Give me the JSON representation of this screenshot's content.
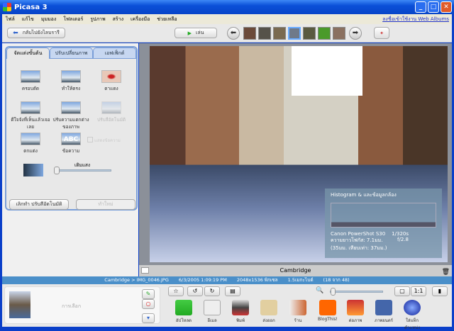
{
  "window": {
    "title": "Picasa 3"
  },
  "menu": [
    "ไฟล์",
    "แก้ไข",
    "มุมมอง",
    "โฟลเดอร์",
    "รูปภาพ",
    "สร้าง",
    "เครื่องมือ",
    "ช่วยเหลือ"
  ],
  "menu_link": "ลงชื่อเข้าใช้งาน Web Albums",
  "toolbar": {
    "back_label": "กลับไปยังไลบรารี",
    "play_label": "เล่น"
  },
  "tabs": [
    "จัดแต่งขั้นต้น",
    "ปรับเปลี่ยนภาพ",
    "เอฟเฟ็กต์"
  ],
  "tools": [
    "ครอบตัด",
    "ทำให้ตรง",
    "ตาแดง",
    "ดีใจจังที่เห็นแล้วเจอเลย",
    "ปรับความแตกต่างของภาพ",
    "ปรับสีอัตโนมัติ",
    "ตกแต่ง",
    "ข้อความ"
  ],
  "show_text_checkbox": "แสดงข้อความ",
  "fill_light_label": "เติมแสง",
  "fill_light_value": 0,
  "undo_label": "เลิกทำ ปรับสีอัตโนมัติ",
  "redo_label": "ทำใหม่",
  "histogram": {
    "title": "Histogram & และข้อมูลกล้อง",
    "camera": "Canon PowerShot S30",
    "shutter": "1/320s",
    "focal": "ความยาวโฟกัส: 7.1มม.",
    "aperture": "f/2.8",
    "equiv": "(35มม. เทียบเท่า: 37มม.)"
  },
  "caption": "Cambridge",
  "status": {
    "path": "Cambridge > IMG_0046.JPG",
    "date": "6/3/2005 1:09:19 PM",
    "dimensions": "2048x1536 พิกเซล",
    "size": "1.5เมกะไบต์",
    "position": "(18 จาก 48)"
  },
  "tray_label": "การเลือก",
  "actions": [
    "อัปโหลด",
    "อีเมล",
    "พิมพ์",
    "ส่งออก",
    "ร้าน",
    "BlogThis!",
    "ต่อภาพ",
    "ภาพยนตร์",
    "ใส่แท็กตำแหน่ง"
  ],
  "colors": {
    "titlebar": "#0a4fd8",
    "status": "#4a8fc9",
    "tab_border": "#7a9ed8"
  }
}
